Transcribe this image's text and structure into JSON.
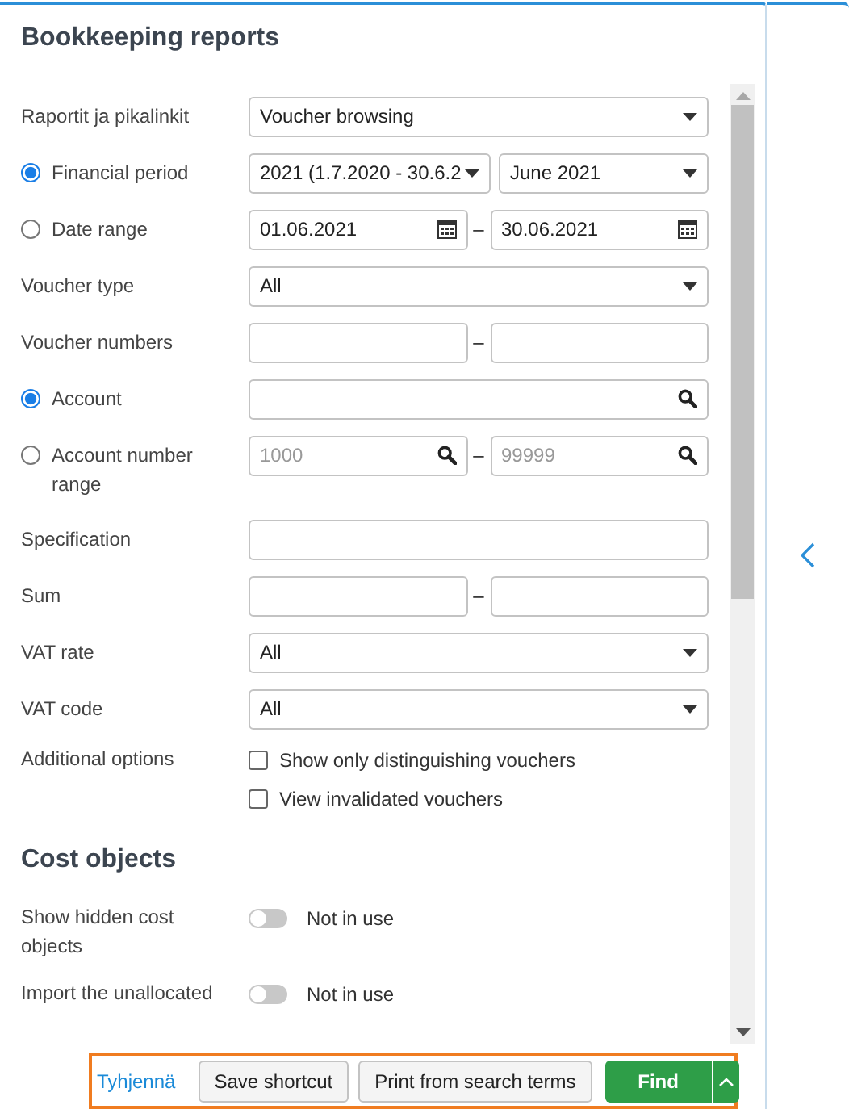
{
  "title": "Bookkeeping reports",
  "fields": [
    {
      "kind": "select",
      "label": "Raportit ja pikalinkit",
      "value": "Voucher browsing"
    },
    {
      "kind": "select_pair",
      "label": "Financial period",
      "selected": true,
      "values": [
        "2021 (1.7.2020 - 30.6.2",
        "June 2021"
      ]
    },
    {
      "kind": "date_pair",
      "label": "Date range",
      "selected": false,
      "values": [
        "01.06.2021",
        "30.06.2021"
      ],
      "separator": "–"
    },
    {
      "kind": "select",
      "label": "Voucher type",
      "value": "All"
    },
    {
      "kind": "text_pair",
      "label": "Voucher numbers",
      "separator": "–"
    },
    {
      "kind": "search",
      "label": "Account",
      "selected": true
    },
    {
      "kind": "search_pair",
      "label": "Account number range",
      "selected": false,
      "placeholders": [
        "1000",
        "99999"
      ],
      "separator": "–"
    },
    {
      "kind": "text",
      "label": "Specification"
    },
    {
      "kind": "text_pair",
      "label": "Sum",
      "separator": "–"
    },
    {
      "kind": "select",
      "label": "VAT rate",
      "value": "All"
    },
    {
      "kind": "select",
      "label": "VAT code",
      "value": "All"
    },
    {
      "kind": "checks",
      "label": "Additional options",
      "options": [
        {
          "label": "Show only distinguishing vouchers",
          "checked": false
        },
        {
          "label": "View invalidated vouchers",
          "checked": false
        }
      ]
    }
  ],
  "cost_objects": {
    "heading": "Cost objects",
    "rows": [
      {
        "label": "Show hidden cost objects",
        "on": false,
        "state": "Not in use"
      },
      {
        "label": "Import the unallocated",
        "on": false,
        "state": "Not in use"
      }
    ]
  },
  "footer": {
    "focused": true,
    "link": "Tyhjennä",
    "buttons": [
      "Save shortcut",
      "Print from search terms"
    ],
    "primary": "Find"
  }
}
